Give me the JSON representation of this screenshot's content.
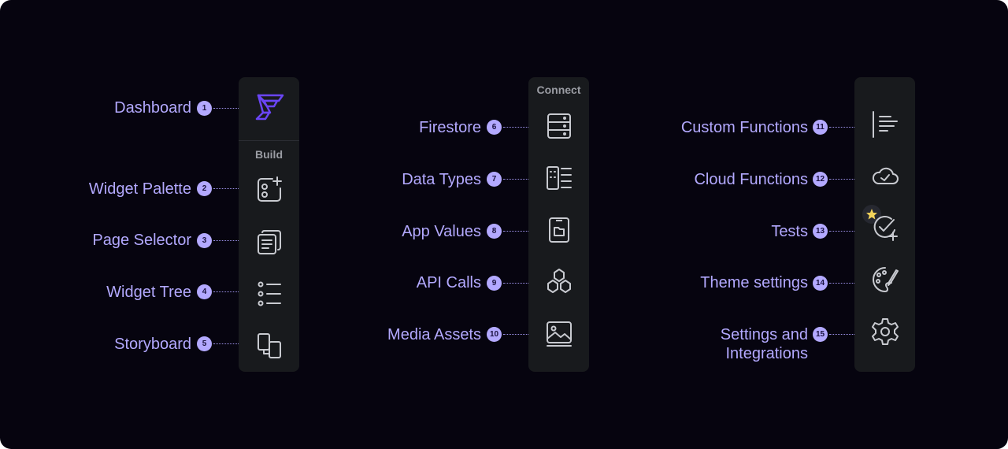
{
  "accent_color": "#b3a9ff",
  "sections": {
    "build_title": "Build",
    "connect_title": "Connect"
  },
  "items": [
    {
      "label": "Dashboard",
      "num": "1",
      "icon": "flutterflow-logo-icon"
    },
    {
      "label": "Widget Palette",
      "num": "2",
      "icon": "widget-palette-icon"
    },
    {
      "label": "Page Selector",
      "num": "3",
      "icon": "page-selector-icon"
    },
    {
      "label": "Widget Tree",
      "num": "4",
      "icon": "widget-tree-icon"
    },
    {
      "label": "Storyboard",
      "num": "5",
      "icon": "storyboard-icon"
    },
    {
      "label": "Firestore",
      "num": "6",
      "icon": "firestore-icon"
    },
    {
      "label": "Data Types",
      "num": "7",
      "icon": "data-types-icon"
    },
    {
      "label": "App Values",
      "num": "8",
      "icon": "app-values-icon"
    },
    {
      "label": "API Calls",
      "num": "9",
      "icon": "api-calls-icon"
    },
    {
      "label": "Media Assets",
      "num": "10",
      "icon": "media-assets-icon"
    },
    {
      "label": "Custom Functions",
      "num": "11",
      "icon": "custom-functions-icon"
    },
    {
      "label": "Cloud Functions",
      "num": "12",
      "icon": "cloud-functions-icon"
    },
    {
      "label": "Tests",
      "num": "13",
      "icon": "tests-icon"
    },
    {
      "label": "Theme settings",
      "num": "14",
      "icon": "theme-settings-icon"
    },
    {
      "label": "Settings and Integrations",
      "num": "15",
      "icon": "settings-gear-icon"
    }
  ]
}
